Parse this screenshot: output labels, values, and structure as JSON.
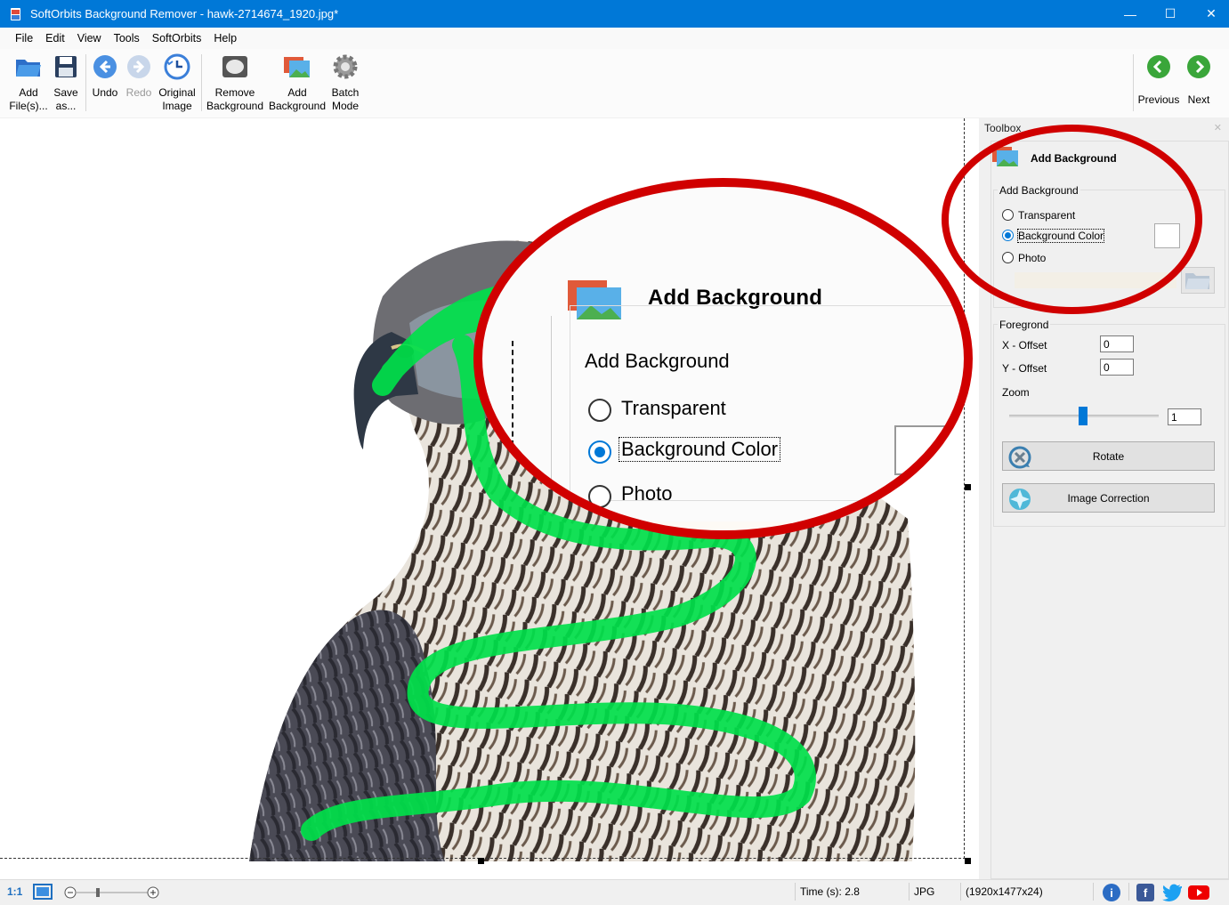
{
  "window": {
    "title": "SoftOrbits Background Remover - hawk-2714674_1920.jpg*",
    "minimize": "—",
    "maximize": "☐",
    "close": "✕"
  },
  "menu": [
    "File",
    "Edit",
    "View",
    "Tools",
    "SoftOrbits",
    "Help"
  ],
  "toolbar": {
    "add_files": "Add\nFile(s)...",
    "save_as": "Save\nas...",
    "undo": "Undo",
    "redo": "Redo",
    "original_image": "Original\nImage",
    "remove_background": "Remove\nBackground",
    "add_background": "Add\nBackground",
    "batch_mode": "Batch\nMode",
    "previous": "Previous",
    "next": "Next"
  },
  "callout": {
    "title": "Add Background",
    "group_label": "Add Background",
    "options": [
      "Transparent",
      "Background Color",
      "Photo"
    ],
    "selected": "Background Color"
  },
  "toolbox": {
    "header": "Toolbox",
    "close": "✕",
    "title": "Add Background",
    "add_background_group": "Add Background",
    "options": [
      "Transparent",
      "Background Color",
      "Photo"
    ],
    "selected": "Background Color",
    "foreground_group": "Foregrond",
    "x_offset_label": "X - Offset",
    "x_offset_value": "0",
    "y_offset_label": "Y - Offset",
    "y_offset_value": "0",
    "zoom_label": "Zoom",
    "zoom_value": "1",
    "rotate_button": "Rotate",
    "image_correction_button": "Image Correction"
  },
  "status": {
    "scale": "1:1",
    "time": "Time (s): 2.8",
    "format": "JPG",
    "dimensions": "(1920x1477x24)",
    "info_icon": "i",
    "facebook_icon": "f"
  },
  "colors": {
    "accent": "#0078d7",
    "highlight_ring": "#d00000",
    "brush_stroke": "#00e04a"
  }
}
